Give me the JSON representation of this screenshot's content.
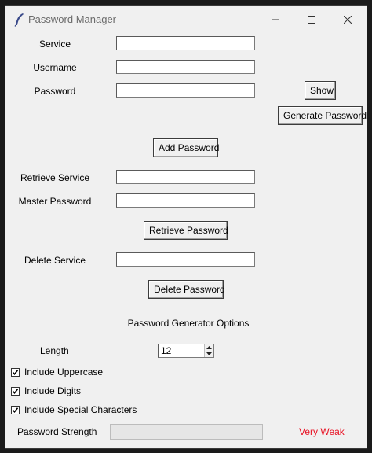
{
  "window": {
    "title": "Password Manager"
  },
  "form": {
    "service_label": "Service",
    "username_label": "Username",
    "password_label": "Password",
    "service_value": "",
    "username_value": "",
    "password_value": "",
    "show_label": "Show",
    "generate_label": "Generate Password",
    "add_label": "Add Password"
  },
  "retrieve": {
    "service_label": "Retrieve Service",
    "master_label": "Master Password",
    "service_value": "",
    "master_value": "",
    "button_label": "Retrieve Password"
  },
  "delete": {
    "service_label": "Delete Service",
    "service_value": "",
    "button_label": "Delete Password"
  },
  "generator": {
    "heading": "Password Generator Options",
    "length_label": "Length",
    "length_value": "12",
    "uppercase_label": "Include Uppercase",
    "uppercase_checked": true,
    "digits_label": "Include Digits",
    "digits_checked": true,
    "special_label": "Include Special Characters",
    "special_checked": true
  },
  "strength": {
    "label": "Password Strength",
    "value_text": "Very Weak",
    "value_color": "#e81123",
    "progress": 0
  },
  "icons": {
    "app": "feather-icon",
    "minimize": "minimize-icon",
    "maximize": "maximize-icon",
    "close": "close-icon"
  }
}
